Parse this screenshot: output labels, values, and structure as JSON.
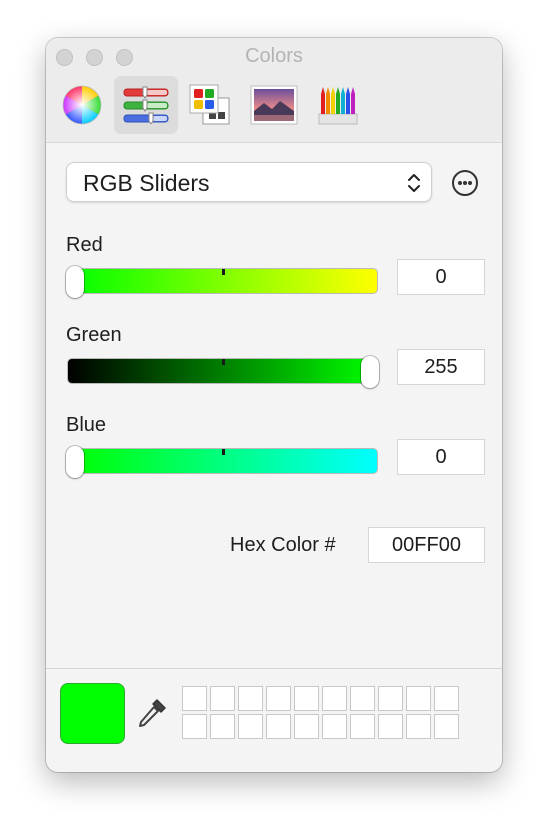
{
  "window": {
    "title": "Colors"
  },
  "toolbar": {
    "tools": [
      {
        "name": "color-wheel",
        "icon": "color-wheel-icon",
        "active": false
      },
      {
        "name": "color-sliders",
        "icon": "sliders-icon",
        "active": true
      },
      {
        "name": "color-palettes",
        "icon": "palettes-icon",
        "active": false
      },
      {
        "name": "image-palettes",
        "icon": "image-icon",
        "active": false
      },
      {
        "name": "pencils",
        "icon": "pencils-icon",
        "active": false
      }
    ]
  },
  "mode_popup": {
    "selected": "RGB Sliders",
    "icon": "up-down-chevron-icon"
  },
  "more_button": {
    "icon": "ellipsis-circle-icon"
  },
  "sliders": {
    "red": {
      "label": "Red",
      "value": "0",
      "level": 0
    },
    "green": {
      "label": "Green",
      "value": "255",
      "level": 1
    },
    "blue": {
      "label": "Blue",
      "value": "0",
      "level": 0
    }
  },
  "hex": {
    "label": "Hex Color #",
    "value": "00FF00"
  },
  "current_color": "#00ff00",
  "eyedropper": {
    "icon": "eyedropper-icon"
  },
  "swatches": {
    "rows": 2,
    "cols": 10
  },
  "colors": {
    "red_track_start": "#00ff00",
    "red_track_end": "#ffff00",
    "green_track_start": "#000000",
    "green_track_end": "#00ff00",
    "blue_track_start": "#00ff00",
    "blue_track_end": "#00ffff"
  }
}
